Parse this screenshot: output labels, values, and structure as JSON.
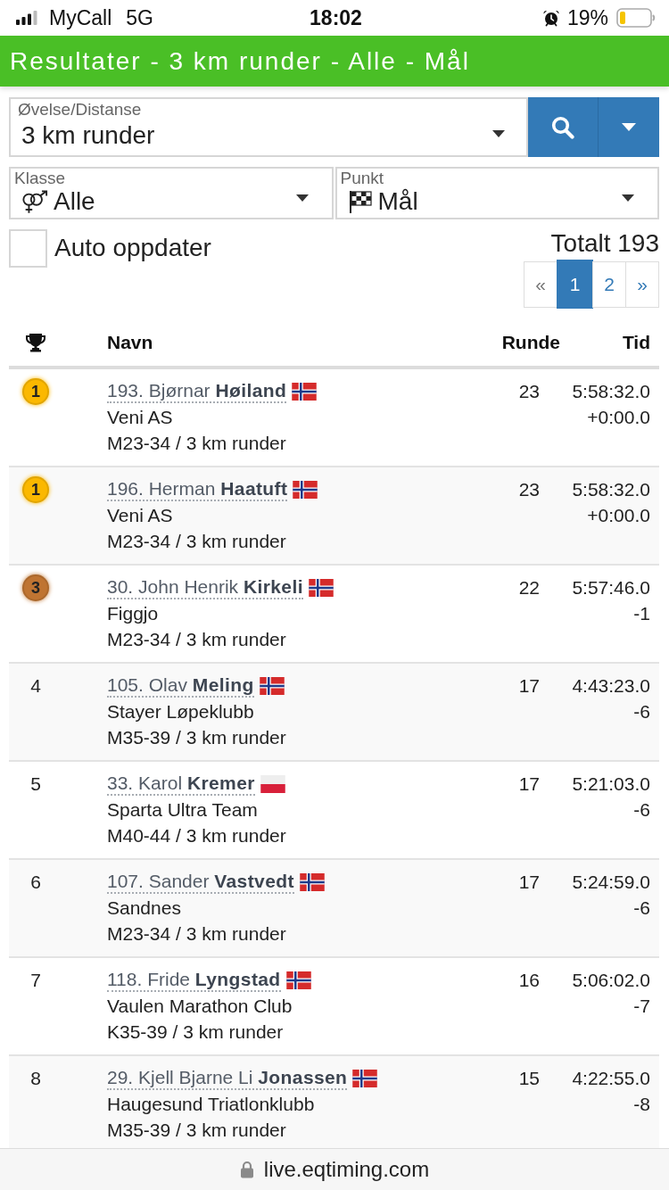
{
  "status_bar": {
    "carrier": "MyCall",
    "network": "5G",
    "time": "18:02",
    "battery": "19%"
  },
  "header": {
    "title": "Resultater - 3 km runder - Alle - Mål"
  },
  "filters": {
    "distance": {
      "label": "Øvelse/Distanse",
      "value": "3 km runder"
    },
    "class": {
      "label": "Klasse",
      "value": "Alle"
    },
    "point": {
      "label": "Punkt",
      "value": "Mål"
    }
  },
  "auto_update": {
    "label": "Auto oppdater",
    "checked": false
  },
  "total": "Totalt 193",
  "pagination": [
    {
      "label": "«",
      "selected": false
    },
    {
      "label": "1",
      "selected": true
    },
    {
      "label": "2",
      "selected": false
    },
    {
      "label": "»",
      "selected": false
    }
  ],
  "table": {
    "columns": [
      "Navn",
      "Runde",
      "Tid"
    ],
    "rows": [
      {
        "kind": "medal",
        "color": "#fbb800",
        "rank": "1",
        "name": "193. Bjørnar **Høiland**",
        "flag": {
          "kind": "norway"
        },
        "club": "Veni AS",
        "class": "M23-34 / 3 km runder",
        "laps": "23",
        "time": "5:58:32.0",
        "gap": "+0:00.0"
      },
      {
        "kind": "medal",
        "color": "#fbb800",
        "rank": "1",
        "name": "196. Herman **Haatuft**",
        "flag": {
          "kind": "norway"
        },
        "club": "Veni AS",
        "class": "M23-34 / 3 km runder",
        "laps": "23",
        "time": "5:58:32.0",
        "gap": "+0:00.0"
      },
      {
        "kind": "medal",
        "color": "#bf7432",
        "rank": "3",
        "name": "30. John Henrik **Kirkeli**",
        "flag": {
          "kind": "norway"
        },
        "club": "Figgjo",
        "class": "M23-34 / 3 km runder",
        "laps": "22",
        "time": "5:57:46.0",
        "gap": "-1"
      },
      {
        "kind": "plain",
        "rank": "4",
        "name": "105. Olav **Meling**",
        "flag": {
          "kind": "norway"
        },
        "club": "Stayer Løpeklubb",
        "class": "M35-39 / 3 km runder",
        "laps": "17",
        "time": "4:43:23.0",
        "gap": "-6"
      },
      {
        "kind": "plain",
        "rank": "5",
        "name": "33. Karol **Kremer**",
        "flag": {
          "kind": "poland"
        },
        "club": "Sparta Ultra Team",
        "class": "M40-44 / 3 km runder",
        "laps": "17",
        "time": "5:21:03.0",
        "gap": "-6"
      },
      {
        "kind": "plain",
        "rank": "6",
        "name": "107. Sander **Vastvedt**",
        "flag": {
          "kind": "norway"
        },
        "club": "Sandnes",
        "class": "M23-34 / 3 km runder",
        "laps": "17",
        "time": "5:24:59.0",
        "gap": "-6"
      },
      {
        "kind": "plain",
        "rank": "7",
        "name": "118. Fride **Lyngstad**",
        "flag": {
          "kind": "norway"
        },
        "club": "Vaulen Marathon Club",
        "class": "K35-39 / 3 km runder",
        "laps": "16",
        "time": "5:06:02.0",
        "gap": "-7"
      },
      {
        "kind": "plain",
        "rank": "8",
        "name": "29. Kjell Bjarne Li **Jonassen**",
        "flag": {
          "kind": "norway"
        },
        "club": "Haugesund Triatlonklubb",
        "class": "M35-39 / 3 km runder",
        "laps": "15",
        "time": "4:22:55.0",
        "gap": "-8"
      }
    ]
  },
  "address_bar": {
    "url": "live.eqtiming.com"
  }
}
